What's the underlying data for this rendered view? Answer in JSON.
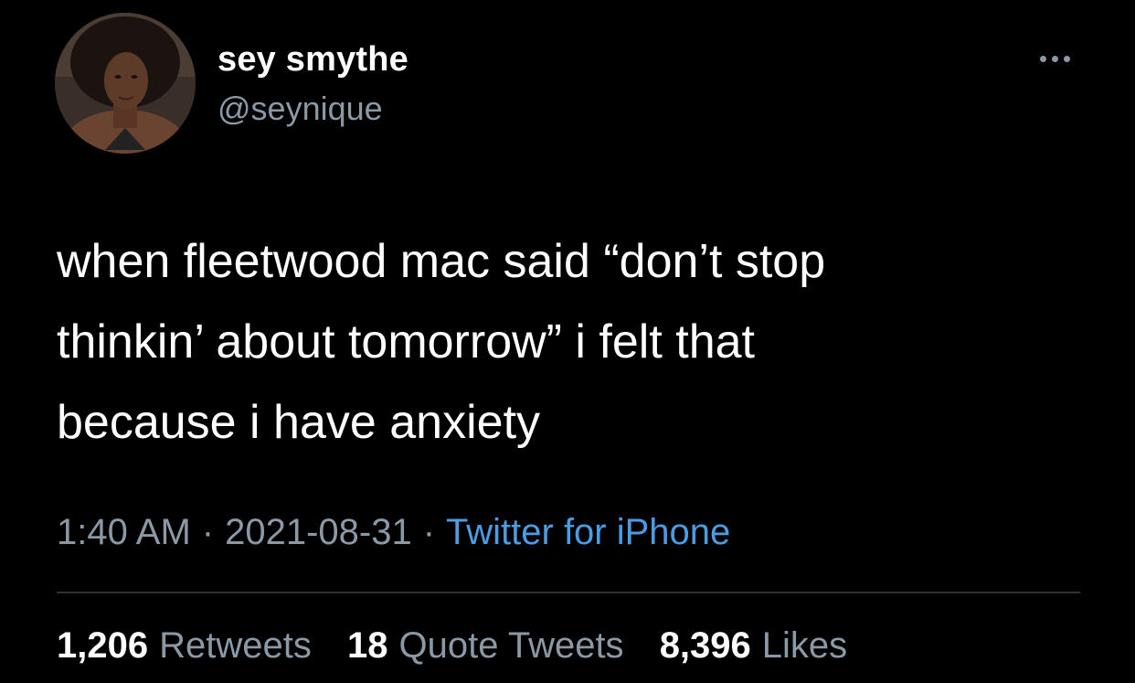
{
  "author": {
    "display_name": "sey smythe",
    "handle": "@seynique",
    "avatar_icon": "profile-photo"
  },
  "menu": {
    "icon": "more-options-icon"
  },
  "tweet": {
    "text_lines": [
      "when fleetwood mac said “don’t stop",
      "thinkin’ about tomorrow” i felt that",
      "because i have anxiety"
    ],
    "time": "1:40 AM",
    "date": "2021-08-31",
    "separator": "·",
    "source": "Twitter for iPhone"
  },
  "stats": {
    "retweets_count": "1,206",
    "retweets_label": "Retweets",
    "quotes_count": "18",
    "quotes_label": "Quote Tweets",
    "likes_count": "8,396",
    "likes_label": "Likes"
  },
  "colors": {
    "background": "#000000",
    "primary_text": "#ffffff",
    "secondary_text": "#8b98a5",
    "link": "#4b9ce3",
    "divider": "#2f3336"
  }
}
